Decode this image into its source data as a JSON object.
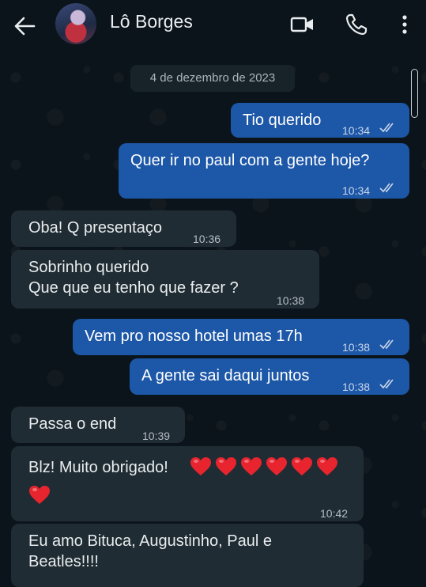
{
  "header": {
    "contact_name": "Lô Borges",
    "icons": [
      "back-arrow-icon",
      "avatar",
      "video-call-icon",
      "phone-icon",
      "more-options-icon"
    ]
  },
  "chat": {
    "date_separator": "4 de dezembro de 2023",
    "messages": [
      {
        "dir": "out",
        "text": "Tio querido",
        "time": "10:34",
        "status": "read"
      },
      {
        "dir": "out",
        "text": "Quer ir no paul com a gente hoje?",
        "time": "10:34",
        "status": "read"
      },
      {
        "dir": "in",
        "text": "Oba! Q presentaço",
        "time": "10:36"
      },
      {
        "dir": "in",
        "line1": "Sobrinho querido",
        "line2": "Que que eu tenho que fazer ?",
        "time": "10:38"
      },
      {
        "dir": "out",
        "text": "Vem pro nosso hotel umas 17h",
        "time": "10:38",
        "status": "read"
      },
      {
        "dir": "out",
        "text": "A gente sai daqui juntos",
        "time": "10:38",
        "status": "read"
      },
      {
        "dir": "in",
        "text": "Passa o end",
        "time": "10:39"
      },
      {
        "dir": "in",
        "text": "Blz! Muito obrigado!",
        "hearts": 7,
        "time": "10:42"
      },
      {
        "dir": "in",
        "line1": "Eu amo Bituca, Augustinho, Paul e",
        "line2": "Beatles!!!!"
      }
    ]
  },
  "colors": {
    "outgoing": "#1d57a8",
    "incoming": "#202c33",
    "background": "#0b141a",
    "heart": "#e8242f"
  }
}
